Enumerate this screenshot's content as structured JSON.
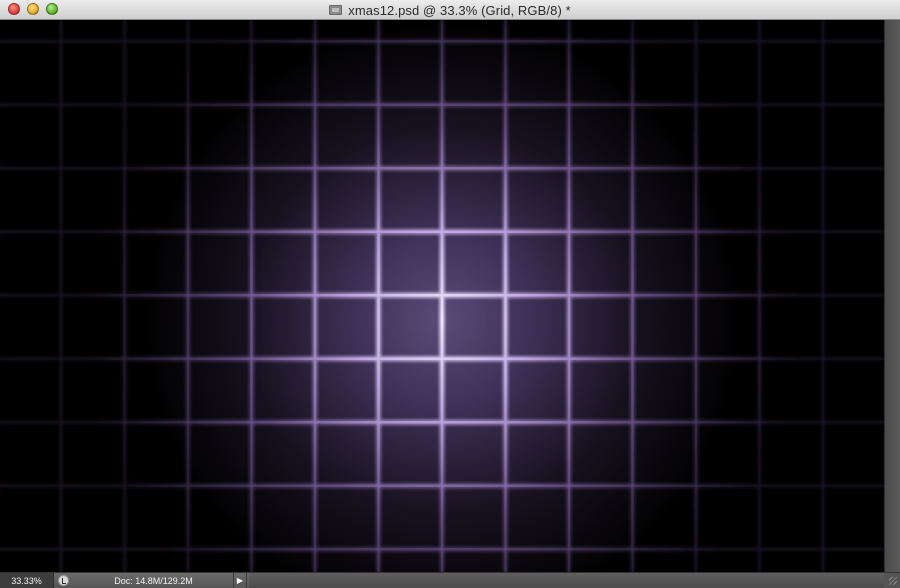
{
  "window": {
    "title": "xmas12.psd @ 33.3% (Grid, RGB/8) *",
    "controls": {
      "close_color": "#e0443b",
      "minimize_color": "#e8ac28",
      "zoom_color": "#5fb82e"
    }
  },
  "canvas": {
    "background": "#000000",
    "grid_line_color": "#b9a2d9",
    "glow_color": "#7a679c",
    "cell_count_x": 14,
    "cell_count_y": 9
  },
  "statusbar": {
    "zoom": "33.33%",
    "doc_info": "Doc: 14.8M/129.2M",
    "arrow": "▶"
  }
}
